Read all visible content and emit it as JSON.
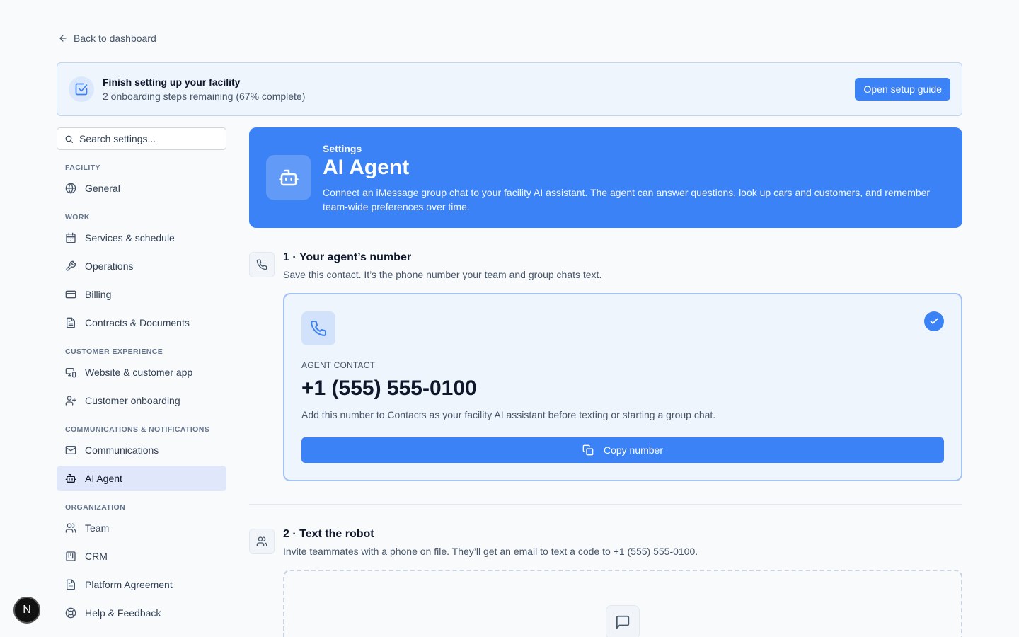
{
  "back_link": {
    "label": "Back to dashboard"
  },
  "banner": {
    "title": "Finish setting up your facility",
    "subtitle": "2 onboarding steps remaining (67% complete)",
    "button_label": "Open setup guide"
  },
  "sidebar": {
    "search_placeholder": "Search settings...",
    "sections": [
      {
        "label": "Facility",
        "items": [
          {
            "label": "General",
            "icon": "globe-icon"
          }
        ]
      },
      {
        "label": "Work",
        "items": [
          {
            "label": "Services & schedule",
            "icon": "calendar-icon"
          },
          {
            "label": "Operations",
            "icon": "wrench-icon"
          },
          {
            "label": "Billing",
            "icon": "credit-card-icon"
          },
          {
            "label": "Contracts & Documents",
            "icon": "document-icon"
          }
        ]
      },
      {
        "label": "Customer experience",
        "items": [
          {
            "label": "Website & customer app",
            "icon": "devices-icon"
          },
          {
            "label": "Customer onboarding",
            "icon": "user-plus-icon"
          }
        ]
      },
      {
        "label": "Communications & notifications",
        "items": [
          {
            "label": "Communications",
            "icon": "mail-icon"
          },
          {
            "label": "AI Agent",
            "icon": "bot-icon",
            "active": true
          }
        ]
      },
      {
        "label": "Organization",
        "items": [
          {
            "label": "Team",
            "icon": "users-icon"
          },
          {
            "label": "CRM",
            "icon": "kanban-icon"
          },
          {
            "label": "Platform Agreement",
            "icon": "document-icon"
          },
          {
            "label": "Help & Feedback",
            "icon": "lifebuoy-icon"
          }
        ]
      }
    ]
  },
  "hero": {
    "eyebrow": "Settings",
    "title": "AI Agent",
    "description": "Connect an iMessage group chat to your facility AI assistant. The agent can answer questions, look up cars and customers, and remember team-wide preferences over time.",
    "icon": "bot-icon"
  },
  "step1": {
    "title": "1 · Your agent’s number",
    "subtitle": "Save this contact. It’s the phone number your team and group chats text.",
    "card": {
      "label": "Agent contact",
      "number": "+1 (555) 555-0100",
      "help": "Add this number to Contacts as your facility AI assistant before texting or starting a group chat.",
      "copy_label": "Copy number"
    }
  },
  "step2": {
    "title": "2 · Text the robot",
    "subtitle": "Invite teammates with a phone on file. They’ll get an email to text a code to +1 (555) 555-0100."
  },
  "badge": {
    "letter": "N"
  },
  "colors": {
    "accent": "#3b82f6",
    "banner_bg": "#eff5fd",
    "active_nav": "#e0e7fb"
  }
}
